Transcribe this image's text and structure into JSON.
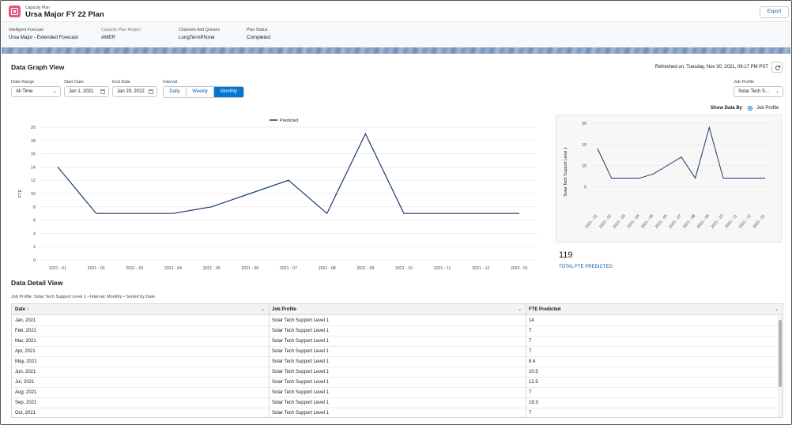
{
  "header": {
    "object_label": "Capacity Plan",
    "title": "Ursa Major FY 22 Plan",
    "export_label": "Export"
  },
  "highlights": [
    {
      "label": "Intelligent Forecast",
      "value": "Ursa Major - Extended Forecast"
    },
    {
      "label": "Capacity Plan Region",
      "value": "AMER"
    },
    {
      "label": "Channels And Queues",
      "value": "LongTermPhone"
    },
    {
      "label": "Plan Status",
      "value": "Completed"
    }
  ],
  "graph_view": {
    "title": "Data Graph View",
    "refreshed": "Refreshed on: Tuesday, Nov 30, 2021, 09:17 PM PST",
    "filters": {
      "date_range_label": "Date Range",
      "date_range_value": "All Time",
      "start_date_label": "Start Date",
      "start_date_value": "Jan 1, 2021",
      "end_date_label": "End Date",
      "end_date_value": "Jan 29, 2022",
      "interval_label": "Interval",
      "interval_options": [
        "Daily",
        "Weekly",
        "Monthly"
      ],
      "interval_selected": "Monthly",
      "job_profile_label": "Job Profile",
      "job_profile_value": "Solar Tech S..."
    },
    "show_data_by_label": "Show Data By",
    "show_data_by_option": "Job Profile",
    "total_value": "119",
    "total_label": "TOTAL FTE PREDICTED"
  },
  "chart_data": [
    {
      "type": "line",
      "legend": [
        "Predicted"
      ],
      "legend_position": "top-center",
      "xlabel": "",
      "ylabel": "FTE",
      "ylim": [
        0,
        20
      ],
      "yticks": [
        0,
        2,
        4,
        6,
        8,
        10,
        12,
        14,
        16,
        18,
        20
      ],
      "grid": true,
      "categories": [
        "2021 - 01",
        "2021 - 02",
        "2021 - 03",
        "2021 - 04",
        "2021 - 05",
        "2021 - 06",
        "2021 - 07",
        "2021 - 08",
        "2021 - 09",
        "2021 - 10",
        "2021 - 11",
        "2021 - 12",
        "2022 - 01"
      ],
      "series": [
        {
          "name": "Predicted",
          "values": [
            14,
            7,
            7,
            7,
            8,
            10,
            12,
            7,
            19,
            7,
            7,
            7,
            7
          ],
          "color": "#1b3a68"
        }
      ]
    },
    {
      "type": "line",
      "ylabel": "Solar Tech Support Level 1",
      "ylim": [
        0,
        20
      ],
      "yticks": [
        5,
        10,
        15,
        20
      ],
      "grid": true,
      "categories": [
        "2021 - 01",
        "2021 - 02",
        "2021 - 03",
        "2021 - 04",
        "2021 - 05",
        "2021 - 06",
        "2021 - 07",
        "2021 - 08",
        "2021 - 09",
        "2021 - 10",
        "2021 - 11",
        "2021 - 12",
        "2022 - 01"
      ],
      "series": [
        {
          "values": [
            14,
            7,
            7,
            7,
            8,
            10,
            12,
            7,
            19,
            7,
            7,
            7,
            7
          ],
          "color": "#1b3a68"
        }
      ]
    }
  ],
  "detail_view": {
    "title": "Data Detail View",
    "subinfo": "Job Profile: Solar Tech Support Level 1 • Interval: Monthly • Sorted by Date",
    "columns": [
      "Date",
      "Job Profile",
      "FTE Predicted"
    ],
    "sort_indicator": "↑",
    "rows": [
      [
        "Jan, 2021",
        "Solar Tech Support Level 1",
        "14"
      ],
      [
        "Feb, 2021",
        "Solar Tech Support Level 1",
        "7"
      ],
      [
        "Mar, 2021",
        "Solar Tech Support Level 1",
        "7"
      ],
      [
        "Apr, 2021",
        "Solar Tech Support Level 1",
        "7"
      ],
      [
        "May, 2021",
        "Solar Tech Support Level 1",
        "8.4"
      ],
      [
        "Jun, 2021",
        "Solar Tech Support Level 1",
        "10.5"
      ],
      [
        "Jul, 2021",
        "Solar Tech Support Level 1",
        "12.5"
      ],
      [
        "Aug, 2021",
        "Solar Tech Support Level 1",
        "7"
      ],
      [
        "Sep, 2021",
        "Solar Tech Support Level 1",
        "19.3"
      ],
      [
        "Oct, 2021",
        "Solar Tech Support Level 1",
        "7"
      ]
    ]
  }
}
